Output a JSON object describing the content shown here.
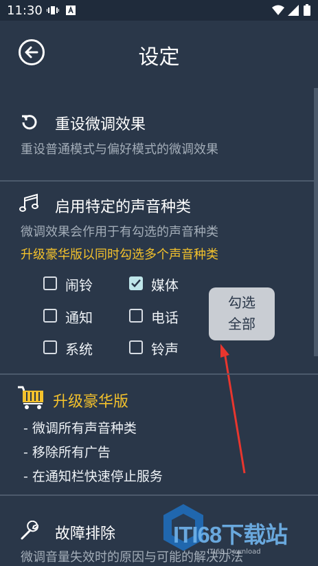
{
  "status_bar": {
    "time": "11:30"
  },
  "header": {
    "title": "设定"
  },
  "reset": {
    "title": "重设微调效果",
    "description": "重设普通模式与偏好模式的微调效果"
  },
  "sound_types": {
    "title": "启用特定的声音种类",
    "description": "微调效果会作用于有勾选的声音种类",
    "promo": "升级豪华版以同时勾选多个声音种类",
    "options": [
      {
        "label": "闹铃",
        "checked": false
      },
      {
        "label": "媒体",
        "checked": true
      },
      {
        "label": "通知",
        "checked": false
      },
      {
        "label": "电话",
        "checked": false
      },
      {
        "label": "系统",
        "checked": false
      },
      {
        "label": "铃声",
        "checked": false
      }
    ],
    "select_all": {
      "line1": "勾选",
      "line2": "全部"
    }
  },
  "upgrade": {
    "title": "升级豪华版",
    "bullets": [
      "- 微调所有声音种类",
      "- 移除所有广告",
      "- 在通知栏快速停止服务"
    ]
  },
  "troubleshoot": {
    "title": "故障排除",
    "description": "微调音量失效时的原因与可能的解决办法"
  },
  "watermark": {
    "text": "ITI68下载站",
    "small": "ITI68 Download"
  },
  "colors": {
    "background": "#2a3749",
    "accent": "#f3c12c",
    "checkbox": "#bfe6ea",
    "annotation": "#e8362e"
  }
}
